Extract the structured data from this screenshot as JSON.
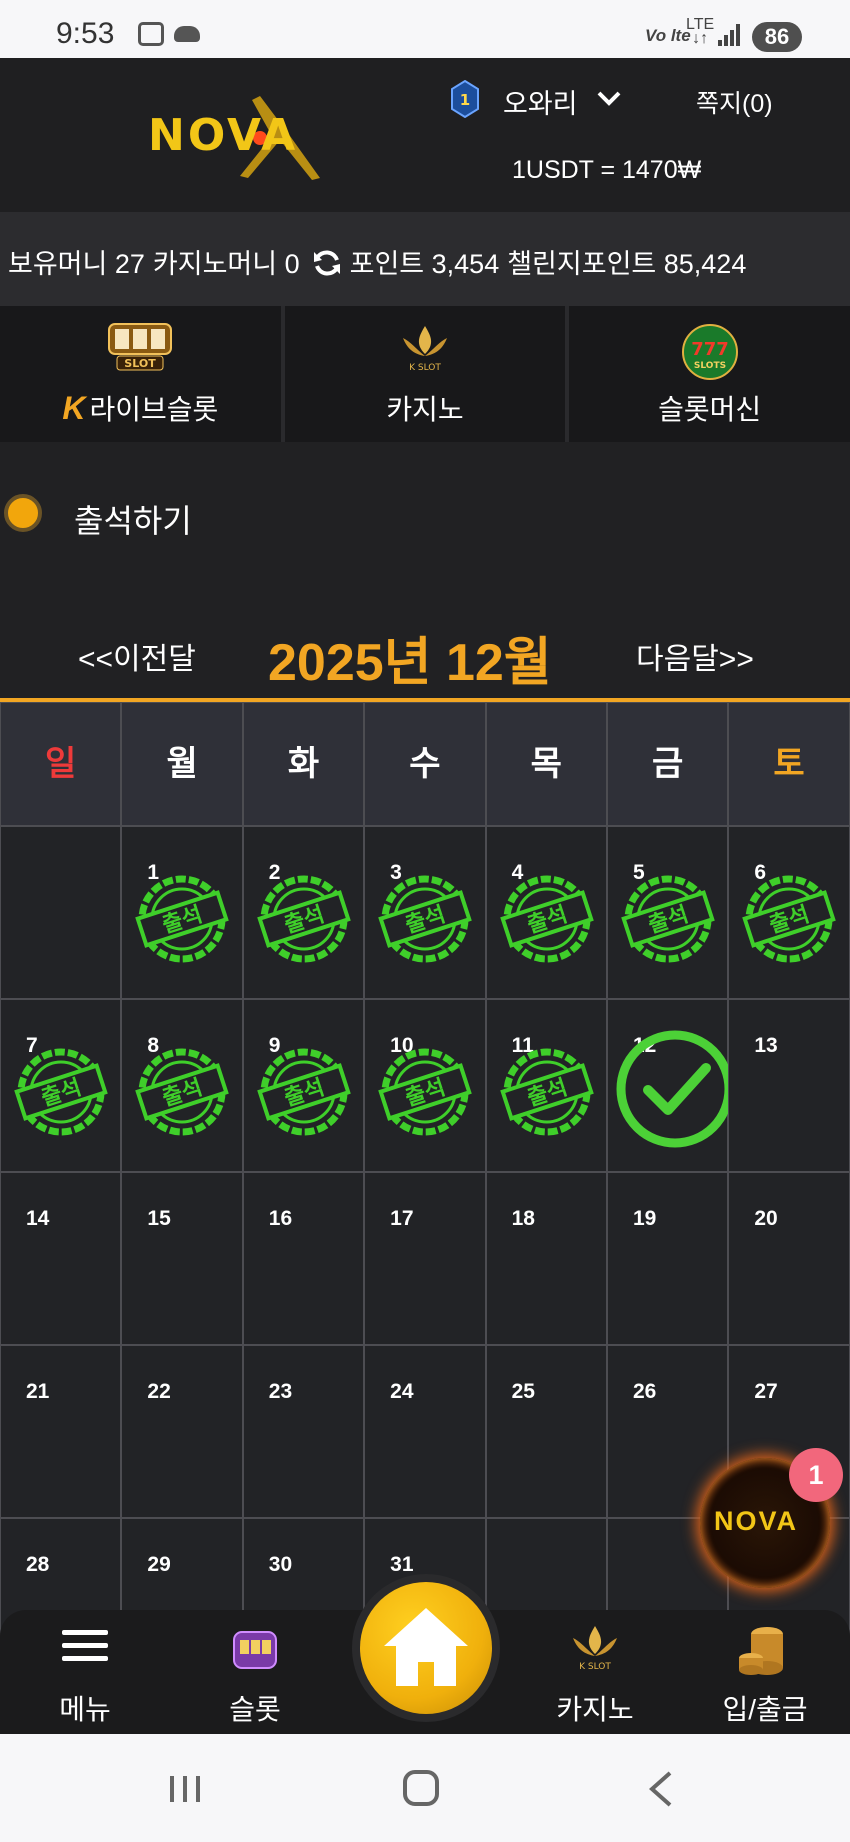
{
  "status_bar": {
    "time": "9:53",
    "volte": "Vo lte",
    "network_top": "LTE",
    "network_bottom": "↓↑",
    "battery": "86"
  },
  "header": {
    "logo_text": "NOVA",
    "rank_level": "1",
    "username": "오와리",
    "messages": "쪽지(0)",
    "exchange_rate": "1USDT = 1470₩"
  },
  "balance": {
    "money": "보유머니 27",
    "casino_money": "카지노머니 0",
    "points": "포인트 3,454",
    "challenge_points": "챌린지포인트 85,424"
  },
  "categories": [
    {
      "label": "라이브슬롯",
      "prefix": "K"
    },
    {
      "label": "카지노"
    },
    {
      "label": "슬롯머신"
    }
  ],
  "attendance": {
    "label": "출석하기",
    "prev": "<<이전달",
    "title": "2025년 12월",
    "next": "다음달>>",
    "weekdays": [
      "일",
      "월",
      "화",
      "수",
      "목",
      "금",
      "토"
    ],
    "stamp_text": "출석",
    "weeks": [
      [
        "",
        "1",
        "2",
        "3",
        "4",
        "5",
        "6"
      ],
      [
        "7",
        "8",
        "9",
        "10",
        "11",
        "12",
        "13"
      ],
      [
        "14",
        "15",
        "16",
        "17",
        "18",
        "19",
        "20"
      ],
      [
        "21",
        "22",
        "23",
        "24",
        "25",
        "26",
        "27"
      ],
      [
        "28",
        "29",
        "30",
        "31",
        "",
        "",
        ""
      ]
    ],
    "attended_days": [
      "1",
      "2",
      "3",
      "4",
      "5",
      "6",
      "7",
      "8",
      "9",
      "10",
      "11"
    ],
    "today": "12"
  },
  "floating": {
    "logo_text": "NOVA",
    "badge": "1"
  },
  "bottom_nav": {
    "menu": "메뉴",
    "slot": "슬롯",
    "casino": "카지노",
    "deposit": "입/출금"
  },
  "colors": {
    "accent": "#f2a623",
    "sunday": "#ee3a3a",
    "stamp": "#3fcf2a",
    "background": "#212123"
  }
}
